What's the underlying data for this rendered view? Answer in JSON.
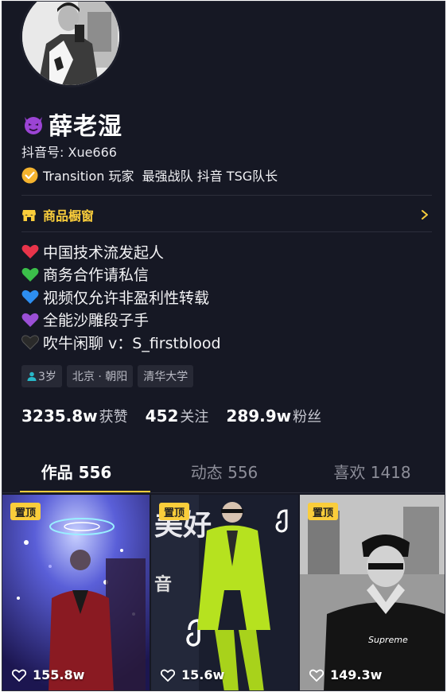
{
  "profile": {
    "name": "薛老湿",
    "account_id": "抖音号: Xue666",
    "verification": "Transition 玩家  最强战队 抖音 TSG队长"
  },
  "shop": {
    "label": "商品橱窗"
  },
  "bio": [
    {
      "heart": "#e8344a",
      "text": "中国技术流发起人"
    },
    {
      "heart": "#3bbf4a",
      "text": "商务合作请私信"
    },
    {
      "heart": "#2d8ef0",
      "text": "视频仅允许非盈利性转载"
    },
    {
      "heart": "#9b4fd6",
      "text": "全能沙雕段子手"
    },
    {
      "heart": "#2a2a2a",
      "text": "吹牛闲聊 v：S_firstblood"
    }
  ],
  "tags": {
    "age": "3岁",
    "location": "北京 · 朝阳",
    "school": "清华大学"
  },
  "stats": [
    {
      "value": "3235.8w",
      "label": "获赞"
    },
    {
      "value": "452",
      "label": "关注"
    },
    {
      "value": "289.9w",
      "label": "粉丝"
    }
  ],
  "tabs": [
    {
      "label": "作品 556",
      "active": true
    },
    {
      "label": "动态 556",
      "active": false
    },
    {
      "label": "喜欢 1418",
      "active": false
    }
  ],
  "videos": [
    {
      "pinned": "置顶",
      "likes": "155.8w"
    },
    {
      "pinned": "置顶",
      "likes": "15.6w"
    },
    {
      "pinned": "置顶",
      "likes": "149.3w"
    }
  ],
  "colors": {
    "background": "#161824",
    "accent": "#facd3b",
    "text_secondary": "#8c8d98"
  }
}
